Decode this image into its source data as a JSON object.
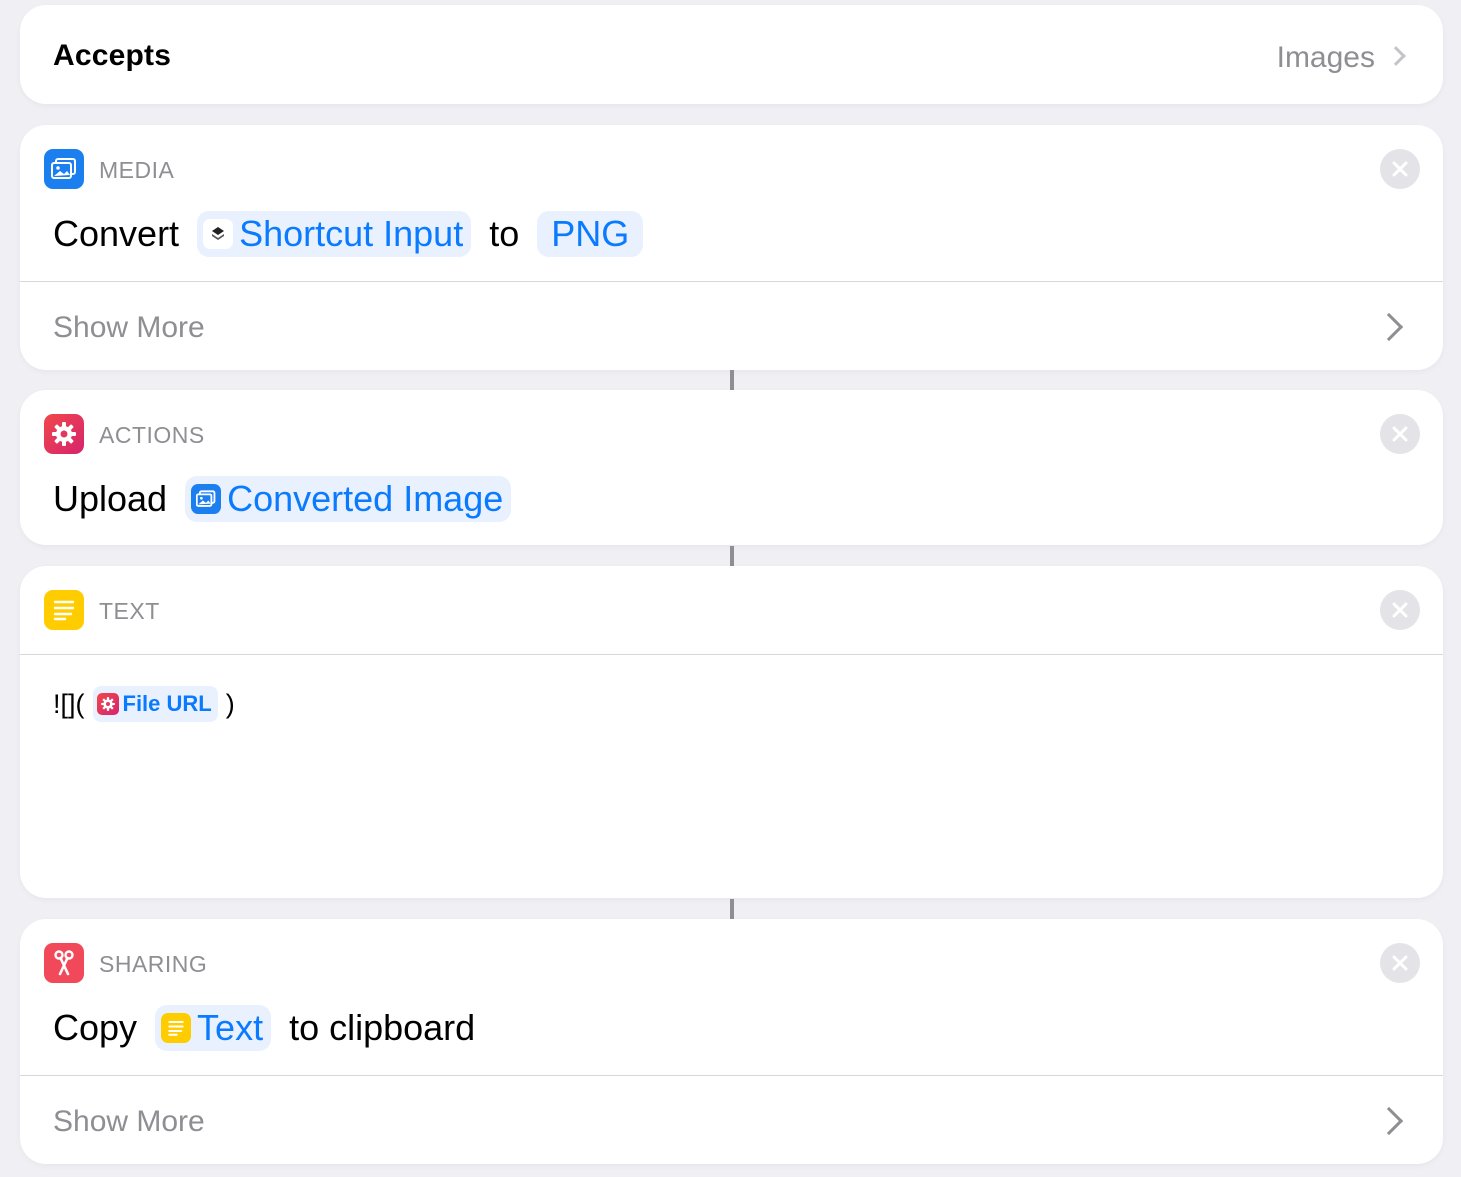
{
  "accepts": {
    "label": "Accepts",
    "value": "Images"
  },
  "colors": {
    "media": "#1c7ff0",
    "actions": "#e8324a",
    "text": "#ffcc00",
    "sharing": "#f2495a",
    "token_text": "#0a7aff",
    "token_bg": "#e8f1fd"
  },
  "media": {
    "category": "MEDIA",
    "icon": "photo-icon",
    "verb": "Convert",
    "input_token": "Shortcut Input",
    "connector": "to",
    "format_token": "PNG",
    "show_more": "Show More"
  },
  "actions": {
    "category": "ACTIONS",
    "icon": "gear-icon",
    "verb": "Upload",
    "input_token": "Converted Image"
  },
  "text": {
    "category": "TEXT",
    "icon": "text-lines-icon",
    "prefix": "![](",
    "token": "File URL",
    "suffix": ")"
  },
  "sharing": {
    "category": "SHARING",
    "icon": "scissors-icon",
    "verb": "Copy",
    "input_token": "Text",
    "suffix": "to clipboard",
    "show_more": "Show More"
  }
}
